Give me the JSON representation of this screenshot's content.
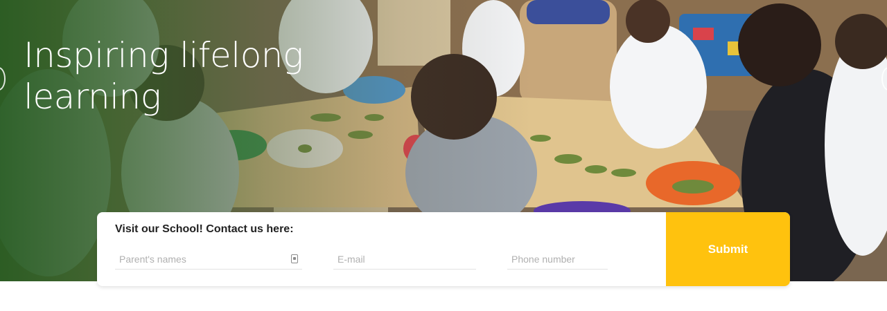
{
  "hero": {
    "title": "Inspiring lifelong learning"
  },
  "contact_form": {
    "heading": "Visit our School! Contact us here:",
    "parent_names_placeholder": "Parent's names",
    "email_placeholder": "E-mail",
    "phone_placeholder": "Phone number",
    "submit_label": "Submit"
  },
  "colors": {
    "accent_submit": "#ffc20e",
    "hero_overlay_green": "#265c20",
    "card_background": "#ffffff"
  },
  "icons": {
    "field_icon": "contact-card-icon",
    "slider_prev": "slider-prev-icon",
    "slider_next": "slider-next-icon"
  }
}
